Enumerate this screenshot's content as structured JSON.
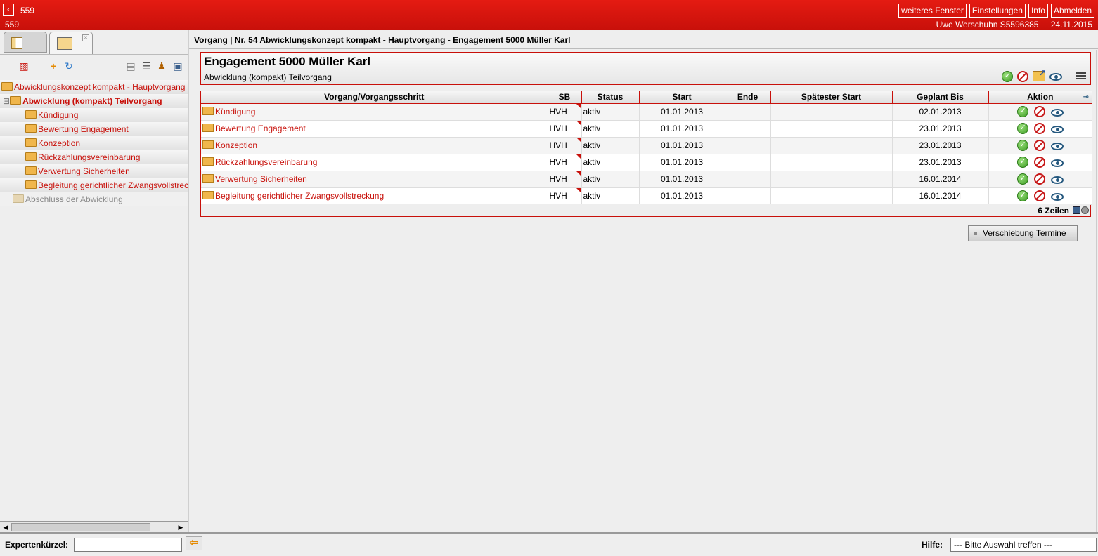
{
  "topbar": {
    "back_icon": "chevron-left-icon",
    "title_num": "559",
    "sub_num": "559",
    "buttons": [
      "weiteres Fenster",
      "Einstellungen",
      "Info",
      "Abmelden"
    ],
    "user": "Uwe Werschuhn S5596385",
    "date": "24.11.2015",
    "accent_color": "#e41b12"
  },
  "left": {
    "tree": [
      {
        "label": "Abwicklungskonzept kompakt - Hauptvorgang",
        "level": 0
      },
      {
        "label": "Abwicklung (kompakt) Teilvorgang",
        "level": 1
      },
      {
        "label": "Kündigung",
        "level": 2
      },
      {
        "label": "Bewertung Engagement",
        "level": 2
      },
      {
        "label": "Konzeption",
        "level": 2
      },
      {
        "label": "Rückzahlungsvereinbarung",
        "level": 2
      },
      {
        "label": "Verwertung Sicherheiten",
        "level": 2
      },
      {
        "label": "Begleitung gerichtlicher Zwangsvollstreckung",
        "level": 2
      },
      {
        "label": "Abschluss der Abwicklung",
        "level": 1
      }
    ]
  },
  "main": {
    "breadcrumb": "Vorgang | Nr. 54 Abwicklungskonzept kompakt - Hauptvorgang - Engagement 5000 Müller Karl",
    "title": "Engagement 5000 Müller Karl",
    "subtitle": "Abwicklung (kompakt) Teilvorgang",
    "columns": [
      "Vorgang/Vorgangsschritt",
      "SB",
      "Status",
      "Start",
      "Ende",
      "Spätester Start",
      "Geplant Bis",
      "Aktion"
    ],
    "rows": [
      {
        "name": "Kündigung",
        "sb": "HVH",
        "status": "aktiv",
        "start": "01.01.2013",
        "ende": "",
        "spaetester": "",
        "geplant": "02.01.2013"
      },
      {
        "name": "Bewertung Engagement",
        "sb": "HVH",
        "status": "aktiv",
        "start": "01.01.2013",
        "ende": "",
        "spaetester": "",
        "geplant": "23.01.2013"
      },
      {
        "name": "Konzeption",
        "sb": "HVH",
        "status": "aktiv",
        "start": "01.01.2013",
        "ende": "",
        "spaetester": "",
        "geplant": "23.01.2013"
      },
      {
        "name": "Rückzahlungsvereinbarung",
        "sb": "HVH",
        "status": "aktiv",
        "start": "01.01.2013",
        "ende": "",
        "spaetester": "",
        "geplant": "23.01.2013"
      },
      {
        "name": "Verwertung Sicherheiten",
        "sb": "HVH",
        "status": "aktiv",
        "start": "01.01.2013",
        "ende": "",
        "spaetester": "",
        "geplant": "16.01.2014"
      },
      {
        "name": "Begleitung gerichtlicher Zwangsvollstreckung",
        "sb": "HVH",
        "status": "aktiv",
        "start": "01.01.2013",
        "ende": "",
        "spaetester": "",
        "geplant": "16.01.2014"
      }
    ],
    "row_count": "6 Zeilen",
    "shift_button": "Verschiebung Termine"
  },
  "bottom": {
    "expert_label": "Expertenkürzel:",
    "expert_value": "",
    "help_label": "Hilfe:",
    "help_selected": "--- Bitte Auswahl treffen ---"
  }
}
